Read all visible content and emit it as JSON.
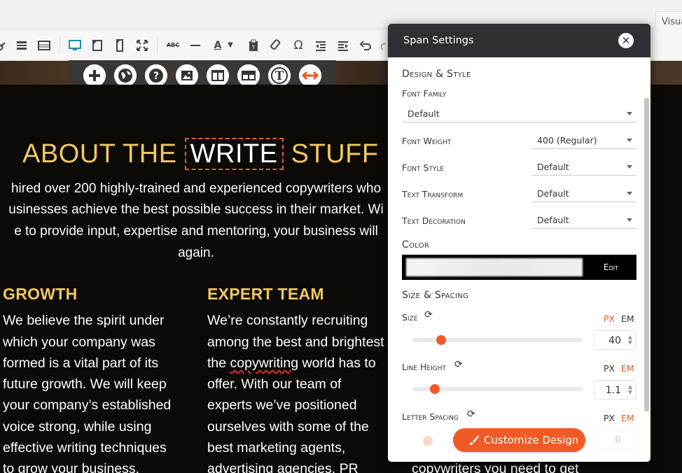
{
  "editor": {
    "visual_tab": "Visua"
  },
  "content": {
    "title_pre": "ABOUT THE ",
    "title_highlight": "WRITE",
    "title_post": " STUFF",
    "para_lines": [
      "hired over 200 highly-trained and experienced copywriters who",
      "usinesses achieve the best possible success in their market. Wi",
      "e to provide input, expertise and mentoring, your business will",
      "again."
    ],
    "col1": {
      "title": "GROWTH",
      "lines": [
        "We believe the spirit under",
        "which your company was",
        "formed is a vital part of its",
        "future growth. We will keep",
        "your company’s established",
        "voice strong, while using",
        "effective writing techniques",
        "to grow your business."
      ]
    },
    "col2": {
      "title": "EXPERT TEAM",
      "lines": [
        "We’re constantly recruiting",
        "among the best and brightest",
        "the copywriting world has to",
        "offer. With our team of",
        "experts we’ve positioned",
        "ourselves with some of the",
        "best marketing agents,",
        "advertising agencies, PR"
      ],
      "squiggle_word": "copywriting"
    },
    "col3_peek": "copywriters you need to get"
  },
  "modal": {
    "title": "Span Settings",
    "design_title": "Design & Style",
    "font_family_label": "Font Family",
    "font_family_value": "Default",
    "font_weight_label": "Font Weight",
    "font_weight_value": "400 (Regular)",
    "font_style_label": "Font Style",
    "font_style_value": "Default",
    "text_transform_label": "Text Transform",
    "text_transform_value": "Default",
    "text_decoration_label": "Text Decoration",
    "text_decoration_value": "Default",
    "color_label": "Color",
    "color_edit": "Edit",
    "size_spacing_title": "Size & Spacing",
    "size_label": "Size",
    "size_value": "40",
    "size_unit_active": "PX",
    "size_slider_fraction": 0.17,
    "line_height_label": "Line Height",
    "line_height_value": "1.1",
    "line_height_unit_active": "EM",
    "line_height_slider_fraction": 0.13,
    "letter_spacing_label": "Letter Spacing",
    "letter_spacing_value": "0",
    "unit_px": "PX",
    "unit_em": "EM",
    "customize_button": "Customize Design"
  },
  "colors": {
    "accent": "#ef5a27",
    "heading_gold": "#f0c860",
    "modal_header": "#2f3033"
  }
}
